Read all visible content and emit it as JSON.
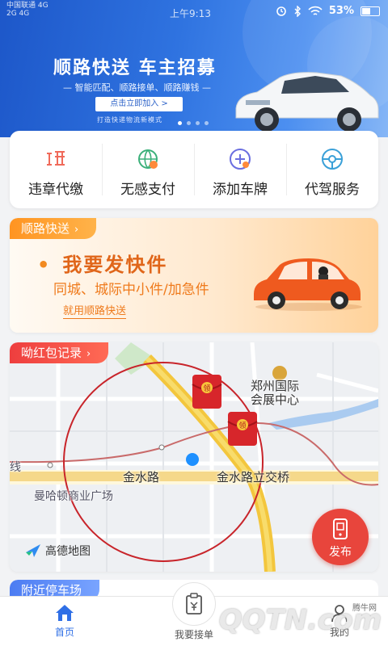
{
  "status_bar": {
    "carrier_line1": "中国联通 4G",
    "carrier_line2": "2G 4G",
    "time": "上午9:13",
    "battery": "53%",
    "battery_level": 0.53
  },
  "banner": {
    "title": "顺路快送  车主招募",
    "subtitle": "— 智能匹配、顺路接单、顺路赚钱 —",
    "button": "点击立即加入 >",
    "footer": "打造快递物流新模式",
    "slide_count": 4,
    "active_slide": 0
  },
  "services": [
    {
      "label": "违章代缴",
      "icon": "violation-pay-icon",
      "color": "#f06a5a"
    },
    {
      "label": "无感支付",
      "icon": "senseless-pay-icon",
      "color": "#3bb07a"
    },
    {
      "label": "添加车牌",
      "icon": "add-plate-icon",
      "color": "#6a6ee0"
    },
    {
      "label": "代驾服务",
      "icon": "chauffeur-icon",
      "color": "#3aa0d8"
    }
  ],
  "delivery": {
    "tag": "顺路快送",
    "bullet": "•",
    "title": "我要发快件",
    "subtitle": "同城、城际中小件/加急件",
    "link": "就用顺路快送",
    "accent": "#ef7a1c"
  },
  "map": {
    "tag": "呦红包记录",
    "labels": {
      "convention": "郑州国际\n会展中心",
      "road": "金水路",
      "bridge": "金水路立交桥",
      "mall": "曼哈顿商业广场",
      "edge": "线"
    },
    "publish_label": "发布",
    "provider": "高德地图",
    "red_packet_char": "领"
  },
  "parking": {
    "tag": "附近停车场"
  },
  "nav": {
    "home": "首页",
    "order": "我要接单",
    "mine": "我的",
    "active_color": "#2f6fe6"
  },
  "watermark": {
    "main": "QQTN.com",
    "small": "腾牛网"
  }
}
